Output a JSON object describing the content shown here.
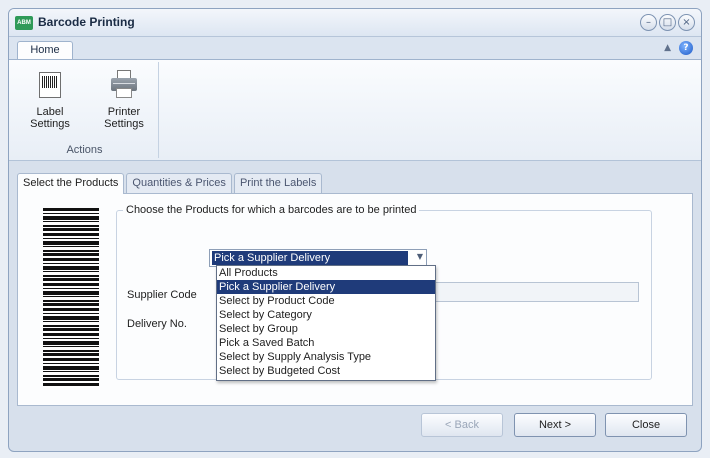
{
  "window": {
    "title": "Barcode Printing",
    "app_icon_text": "ABM"
  },
  "ribbon": {
    "tab_home": "Home",
    "label_settings": "Label\nSettings",
    "printer_settings": "Printer\nSettings",
    "group_caption": "Actions"
  },
  "tabs": [
    "Select the Products",
    "Quantities & Prices",
    "Print the Labels"
  ],
  "form": {
    "legend": "Choose the Products for which a barcodes are to be printed",
    "selected_option": "Pick a Supplier Delivery",
    "supplier_code_label": "Supplier Code",
    "delivery_no_label": "Delivery No.",
    "options": [
      "All Products",
      "Pick a Supplier Delivery",
      "Select by Product Code",
      "Select by Category",
      "Select by Group",
      "Pick a Saved Batch",
      "Select by Supply Analysis Type",
      "Select by Budgeted Cost"
    ]
  },
  "buttons": {
    "back": "< Back",
    "next": "Next >",
    "close": "Close"
  },
  "colors": {
    "selection": "#1f3b7a",
    "app_icon": "#2f9a58"
  }
}
